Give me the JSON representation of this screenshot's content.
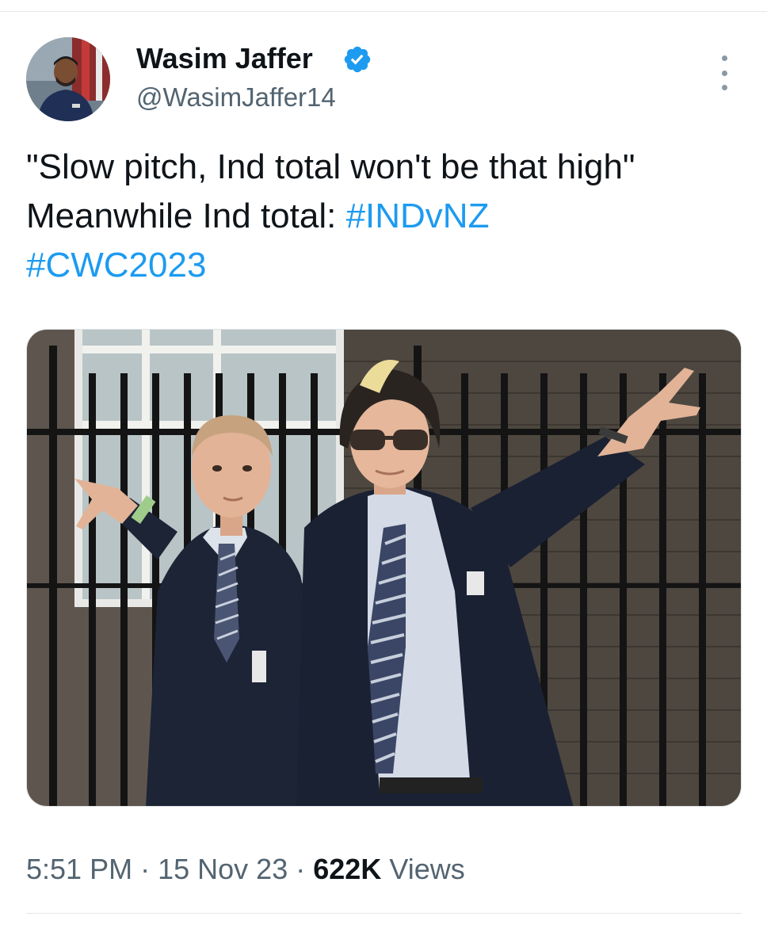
{
  "author": {
    "display_name": "Wasim Jaffer",
    "handle": "@WasimJaffer14",
    "verified": true,
    "avatar_icon": "profile-photo"
  },
  "tweet": {
    "line1": "\"Slow pitch, Ind total won't be that high\"",
    "line2_prefix": "Meanwhile Ind total: ",
    "hashtag1": "#INDvNZ",
    "hashtag2": "#CWC2023"
  },
  "media": {
    "type": "photo",
    "icon": "photo-two-cricketers-in-blazers"
  },
  "meta": {
    "time": "5:51 PM",
    "separator": "·",
    "date": "15 Nov 23",
    "views_count": "622K",
    "views_label": "Views"
  },
  "colors": {
    "link": "#1d9bf0",
    "verified": "#1d9bf0",
    "text": "#0f1419",
    "secondary": "#536471"
  }
}
